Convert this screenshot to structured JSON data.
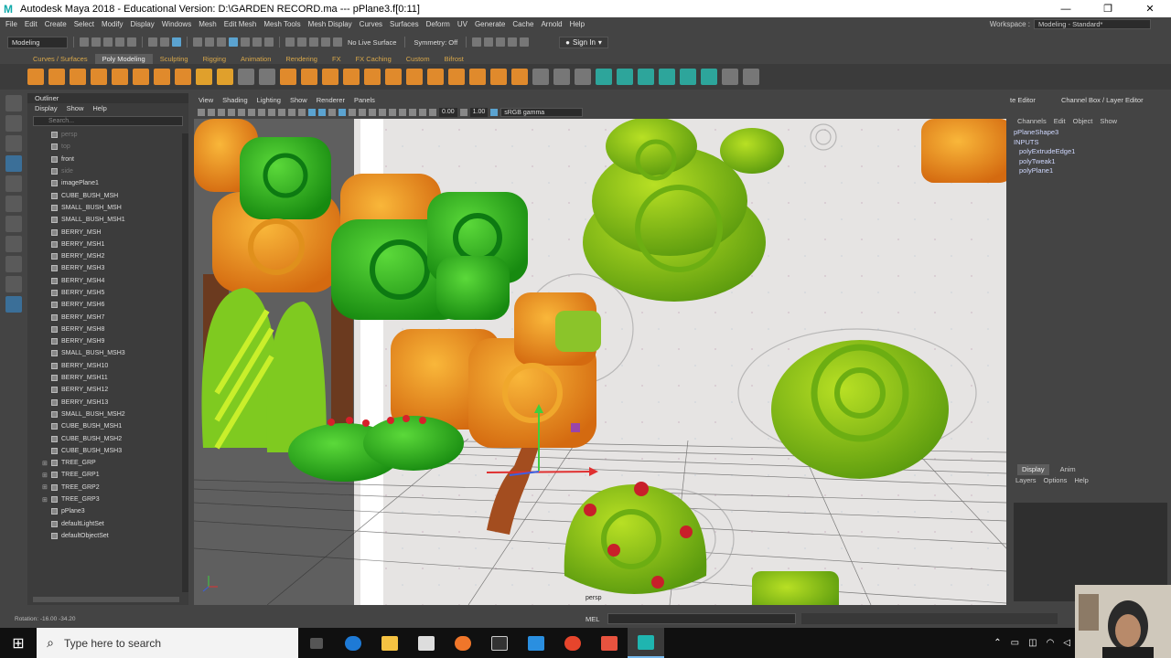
{
  "titlebar": {
    "title": "Autodesk Maya 2018 - Educational Version: D:\\GARDEN RECORD.ma  ---  pPlane3.f[0:11]",
    "min": "—",
    "max": "❐",
    "close": "✕"
  },
  "menus": [
    "File",
    "Edit",
    "Create",
    "Select",
    "Modify",
    "Display",
    "Windows",
    "Mesh",
    "Edit Mesh",
    "Mesh Tools",
    "Mesh Display",
    "Curves",
    "Surfaces",
    "Deform",
    "UV",
    "Generate",
    "Cache",
    "Arnold",
    "Help"
  ],
  "workspace": {
    "label": "Workspace :",
    "value": "Modeling - Standard*"
  },
  "statusline": {
    "mode": "Modeling",
    "live_surface": "No Live Surface",
    "symmetry": "Symmetry: Off",
    "sign_in": "Sign In"
  },
  "shelf_tabs": [
    "Curves / Surfaces",
    "Poly Modeling",
    "Sculpting",
    "Rigging",
    "Animation",
    "Rendering",
    "FX",
    "FX Caching",
    "Custom",
    "Bifrost"
  ],
  "outliner": {
    "title": "Outliner",
    "menu": [
      "Display",
      "Show",
      "Help"
    ],
    "search_placeholder": "Search...",
    "items": [
      {
        "label": "persp",
        "dim": true
      },
      {
        "label": "top",
        "dim": true
      },
      {
        "label": "front",
        "dim": false
      },
      {
        "label": "side",
        "dim": true
      },
      {
        "label": "imagePlane1"
      },
      {
        "label": "CUBE_BUSH_MSH"
      },
      {
        "label": "SMALL_BUSH_MSH"
      },
      {
        "label": "SMALL_BUSH_MSH1"
      },
      {
        "label": "BERRY_MSH"
      },
      {
        "label": "BERRY_MSH1"
      },
      {
        "label": "BERRY_MSH2"
      },
      {
        "label": "BERRY_MSH3"
      },
      {
        "label": "BERRY_MSH4"
      },
      {
        "label": "BERRY_MSH5"
      },
      {
        "label": "BERRY_MSH6"
      },
      {
        "label": "BERRY_MSH7"
      },
      {
        "label": "BERRY_MSH8"
      },
      {
        "label": "BERRY_MSH9"
      },
      {
        "label": "SMALL_BUSH_MSH3"
      },
      {
        "label": "BERRY_MSH10"
      },
      {
        "label": "BERRY_MSH11"
      },
      {
        "label": "BERRY_MSH12"
      },
      {
        "label": "BERRY_MSH13"
      },
      {
        "label": "SMALL_BUSH_MSH2"
      },
      {
        "label": "CUBE_BUSH_MSH1"
      },
      {
        "label": "CUBE_BUSH_MSH2"
      },
      {
        "label": "CUBE_BUSH_MSH3"
      },
      {
        "label": "TREE_GRP",
        "group": true
      },
      {
        "label": "TREE_GRP1",
        "group": true
      },
      {
        "label": "TREE_GRP2",
        "group": true
      },
      {
        "label": "TREE_GRP3",
        "group": true
      },
      {
        "label": "pPlane3"
      },
      {
        "label": "defaultLightSet"
      },
      {
        "label": "defaultObjectSet"
      }
    ]
  },
  "viewport": {
    "menus": [
      "View",
      "Shading",
      "Lighting",
      "Show",
      "Renderer",
      "Panels"
    ],
    "val1": "0.00",
    "val2": "1.00",
    "color_space": "sRGB gamma",
    "camera_label": "persp"
  },
  "channelbox": {
    "tabs": [
      "te Editor",
      "Channel Box / Layer Editor"
    ],
    "menu": [
      "Channels",
      "Edit",
      "Object",
      "Show"
    ],
    "node": "pPlaneShape3",
    "inputs_label": "INPUTS",
    "inputs": [
      "polyExtrudeEdge1",
      "polyTweak1",
      "polyPlane1"
    ]
  },
  "layers": {
    "tabs": [
      "Display",
      "Anim"
    ],
    "menu": [
      "Layers",
      "Options",
      "Help"
    ]
  },
  "helpline": {
    "rotation": "Rotation:  -16.00     -34.20",
    "mel": "MEL"
  },
  "taskbar": {
    "search_placeholder": "Type here to search"
  }
}
